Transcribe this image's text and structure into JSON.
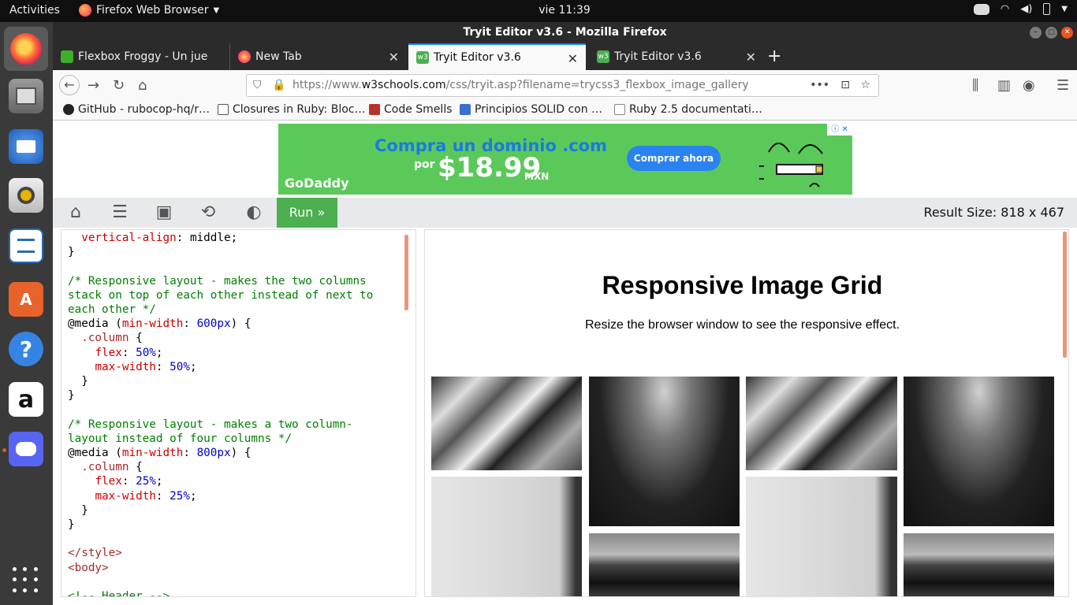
{
  "system": {
    "activities": "Activities",
    "app_name": "Firefox Web Browser",
    "clock": "vie 11:39"
  },
  "window": {
    "title": "Tryit Editor v3.6 - Mozilla Firefox"
  },
  "tabs": [
    {
      "label": "Flexbox Froggy - Un juego",
      "icon": "frog-icon",
      "color": "#3fae2a"
    },
    {
      "label": "New Tab",
      "icon": "firefox-icon",
      "color": "#ff7139"
    },
    {
      "label": "Tryit Editor v3.6",
      "icon": "w3schools-icon",
      "color": "#4caf50",
      "active": true
    },
    {
      "label": "Tryit Editor v3.6",
      "icon": "w3schools-icon",
      "color": "#4caf50"
    }
  ],
  "navigation": {
    "url_prefix": "https://www.",
    "url_domain": "w3schools.com",
    "url_path": "/css/tryit.asp?filename=trycss3_flexbox_image_gallery"
  },
  "bookmarks": [
    {
      "label": "GitHub - rubocop-hq/r…",
      "icon": "github-icon",
      "color": "#222"
    },
    {
      "label": "Closures in Ruby: Bloc…",
      "icon": "crowd-icon",
      "color": "#555"
    },
    {
      "label": "Code Smells",
      "icon": "code-smells-icon",
      "color": "#b5332a"
    },
    {
      "label": "Principios SOLID con …",
      "icon": "solid-icon",
      "color": "#3b6fd1"
    },
    {
      "label": "Ruby 2.5 documentati…",
      "icon": "search-doc-icon",
      "color": "#888"
    }
  ],
  "ad": {
    "headline": "Compra un dominio .com",
    "por": "por",
    "price": "$18.99",
    "currency": "MXN",
    "cta": "Comprar ahora",
    "brand": "GoDaddy"
  },
  "editor_toolbar": {
    "run_label": "Run »",
    "result_size": "Result Size: 818  x  467"
  },
  "code_lines": [
    [
      [
        "  ",
        "p"
      ],
      [
        "vertical-align",
        "pr"
      ],
      [
        ": middle;",
        "p"
      ]
    ],
    [
      [
        "}",
        "p"
      ]
    ],
    [
      [
        "",
        "p"
      ]
    ],
    [
      [
        "/* Responsive layout - makes the two columns",
        "cm"
      ]
    ],
    [
      [
        "stack on top of each other instead of next to",
        "cm"
      ]
    ],
    [
      [
        "each other */",
        "cm"
      ]
    ],
    [
      [
        "@media ",
        "p"
      ],
      [
        "(",
        "p"
      ],
      [
        "min-width",
        "pr"
      ],
      [
        ": ",
        "p"
      ],
      [
        "600px",
        "nu"
      ],
      [
        ") {",
        "p"
      ]
    ],
    [
      [
        "  ",
        "p"
      ],
      [
        ".column",
        "sel"
      ],
      [
        " {",
        "p"
      ]
    ],
    [
      [
        "    ",
        "p"
      ],
      [
        "flex",
        "pr"
      ],
      [
        ": ",
        "p"
      ],
      [
        "50%",
        "nu"
      ],
      [
        ";",
        "p"
      ]
    ],
    [
      [
        "    ",
        "p"
      ],
      [
        "max-width",
        "pr"
      ],
      [
        ": ",
        "p"
      ],
      [
        "50%",
        "nu"
      ],
      [
        ";",
        "p"
      ]
    ],
    [
      [
        "  }",
        "p"
      ]
    ],
    [
      [
        "}",
        "p"
      ]
    ],
    [
      [
        "",
        "p"
      ]
    ],
    [
      [
        "/* Responsive layout - makes a two column-",
        "cm"
      ]
    ],
    [
      [
        "layout instead of four columns */",
        "cm"
      ]
    ],
    [
      [
        "@media ",
        "p"
      ],
      [
        "(",
        "p"
      ],
      [
        "min-width",
        "pr"
      ],
      [
        ": ",
        "p"
      ],
      [
        "800px",
        "nu"
      ],
      [
        ") {",
        "p"
      ]
    ],
    [
      [
        "  ",
        "p"
      ],
      [
        ".column",
        "sel"
      ],
      [
        " {",
        "p"
      ]
    ],
    [
      [
        "    ",
        "p"
      ],
      [
        "flex",
        "pr"
      ],
      [
        ": ",
        "p"
      ],
      [
        "25%",
        "nu"
      ],
      [
        ";",
        "p"
      ]
    ],
    [
      [
        "    ",
        "p"
      ],
      [
        "max-width",
        "pr"
      ],
      [
        ": ",
        "p"
      ],
      [
        "25%",
        "nu"
      ],
      [
        ";",
        "p"
      ]
    ],
    [
      [
        "  }",
        "p"
      ]
    ],
    [
      [
        "}",
        "p"
      ]
    ],
    [
      [
        "",
        "p"
      ]
    ],
    [
      [
        "</style>",
        "tg"
      ]
    ],
    [
      [
        "<body>",
        "tg"
      ]
    ],
    [
      [
        "",
        "p"
      ]
    ],
    [
      [
        "<!-- Header -->",
        "cm"
      ]
    ]
  ],
  "result": {
    "heading": "Responsive Image Grid",
    "subtext": "Resize the browser window to see the responsive effect."
  },
  "colors": {
    "accent": "#0a84ff",
    "run_green": "#4caf50",
    "ad_green": "#5bc95a",
    "scroll_orange": "#e9967a"
  }
}
